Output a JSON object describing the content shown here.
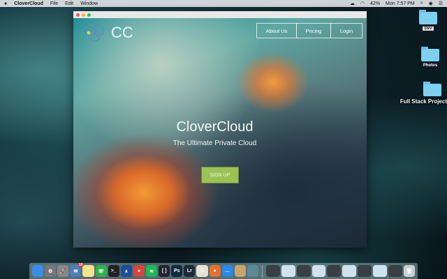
{
  "menubar": {
    "app": "CloverCloud",
    "items": [
      "File",
      "Edit",
      "Window"
    ],
    "battery": "42%",
    "clock": "Mon 7:57 PM"
  },
  "desktop": {
    "folders": [
      "Dev",
      "Photos",
      "Full Stack Project"
    ]
  },
  "site": {
    "logo": "CC",
    "nav": [
      "About Us",
      "Pricing",
      "Login"
    ],
    "title": "CloverCloud",
    "subtitle": "The Ultimate Private Cloud",
    "signup": "SIGN UP"
  },
  "dock": {
    "apps": [
      {
        "name": "finder",
        "label": "",
        "color": "#3a8ee6"
      },
      {
        "name": "system-preferences",
        "label": "⚙",
        "color": "#777"
      },
      {
        "name": "launchpad",
        "label": "🚀",
        "color": "#888"
      },
      {
        "name": "mail",
        "label": "✉",
        "color": "#4a7fb8"
      },
      {
        "name": "notes",
        "label": "",
        "color": "#f5e58a"
      },
      {
        "name": "whatsapp",
        "label": "☏",
        "color": "#2fb14a"
      },
      {
        "name": "terminal",
        "label": ">_",
        "color": "#222"
      },
      {
        "name": "nordvpn",
        "label": "∧",
        "color": "#1b4e9c"
      },
      {
        "name": "chrome",
        "label": "●",
        "color": "#d9453b"
      },
      {
        "name": "spotify",
        "label": "≋",
        "color": "#1db954"
      },
      {
        "name": "brackets",
        "label": "[ ]",
        "color": "#223"
      },
      {
        "name": "photoshop",
        "label": "Ps",
        "color": "#0d2d3d"
      },
      {
        "name": "lightroom",
        "label": "Lr",
        "color": "#1c2a3a"
      },
      {
        "name": "slack",
        "label": "S",
        "color": "#e9e2d2"
      },
      {
        "name": "firefox",
        "label": "●",
        "color": "#e8702a"
      },
      {
        "name": "messenger",
        "label": "…",
        "color": "#2c8ae8"
      },
      {
        "name": "preview",
        "label": "",
        "color": "#c9a56a"
      },
      {
        "name": "unknown-app",
        "label": "",
        "color": "#5a8a96"
      }
    ],
    "badge": "10",
    "trash": "trash"
  }
}
